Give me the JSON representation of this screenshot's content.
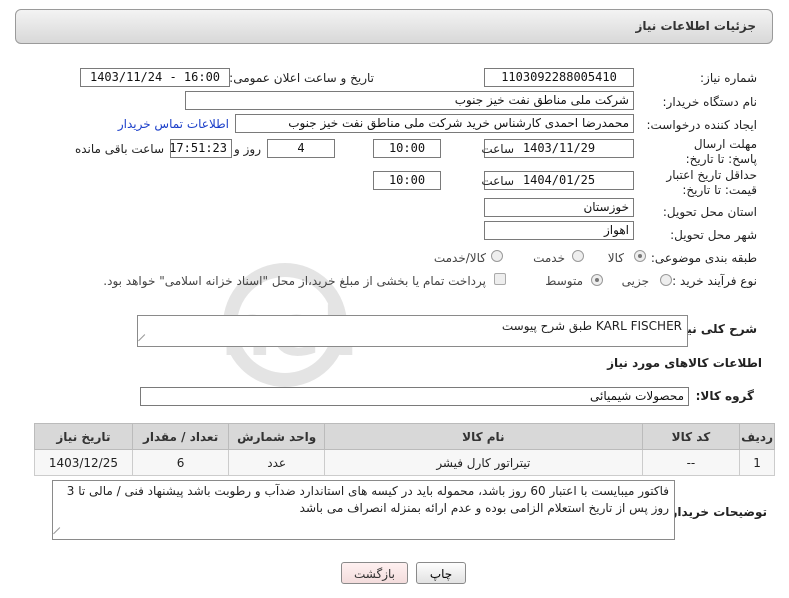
{
  "header": {
    "title": "جزئیات اطلاعات نیاز"
  },
  "form": {
    "need_number_label": "شماره نیاز:",
    "need_number": "1103092288005410",
    "announce_label": "تاریخ و ساعت اعلان عمومی:",
    "announce_value": "1403/11/24 - 16:00",
    "buyer_org_label": "نام دستگاه خریدار:",
    "buyer_org": "شرکت ملی مناطق نفت خیز جنوب",
    "creator_label": "ایجاد کننده درخواست:",
    "creator": "محمدرضا احمدی  کارشناس خرید  شرکت ملی مناطق نفت خیز جنوب",
    "contact_link": "اطلاعات تماس خریدار",
    "deadline_label": "مهلت ارسال پاسخ: تا تاریخ:",
    "deadline_date": "1403/11/29",
    "time_label": "ساعت",
    "deadline_time": "10:00",
    "days_value": "4",
    "days_label": "روز و",
    "remaining_time": "17:51:23",
    "remaining_label": "ساعت باقی مانده",
    "price_validity_label": "حداقل تاریخ اعتبار قیمت: تا تاریخ:",
    "price_validity_date": "1404/01/25",
    "price_validity_time": "10:00",
    "province_label": "استان محل تحویل:",
    "province": "خوزستان",
    "city_label": "شهر محل تحویل:",
    "city": "اهواز",
    "category_label": "طبقه بندی موضوعی:",
    "category_options": [
      "کالا",
      "خدمت",
      "کالا/خدمت"
    ],
    "process_label": "نوع فرآیند خرید :",
    "process_options": [
      "جزیی",
      "متوسط"
    ],
    "payment_note": "پرداخت تمام یا بخشی از مبلغ خرید،از محل \"اسناد خزانه اسلامی\" خواهد بود.",
    "description_label": "شرح کلی نیاز:",
    "description": "KARL FISCHER طبق شرح پیوست",
    "goods_info_heading": "اطلاعات کالاهای مورد نیاز",
    "goods_group_label": "گروه کالا:",
    "goods_group": "محصولات شیمیائی"
  },
  "goods_table": {
    "headers": [
      "ردیف",
      "کد کالا",
      "نام کالا",
      "واحد شمارش",
      "تعداد / مقدار",
      "تاریخ نیاز"
    ],
    "rows": [
      [
        "1",
        "--",
        "تیتراتور کارل فیشر",
        "عدد",
        "6",
        "1403/12/25"
      ]
    ]
  },
  "buyer_notes": {
    "label": "توضیحات خریدار:",
    "text": "فاکتور میبایست با اعتبار 60 روز باشد، محموله باید در کیسه های استاندارد  ضدآب و  رطوبت  باشد پیشنهاد فنی / مالی تا 3 روز پس از تاریخ استعلام الزامی بوده و عدم ارائه بمنزله انصراف می باشد"
  },
  "buttons": {
    "print": "چاپ",
    "back": "بازگشت"
  },
  "watermark": {
    "text": "AriaTender.net"
  }
}
